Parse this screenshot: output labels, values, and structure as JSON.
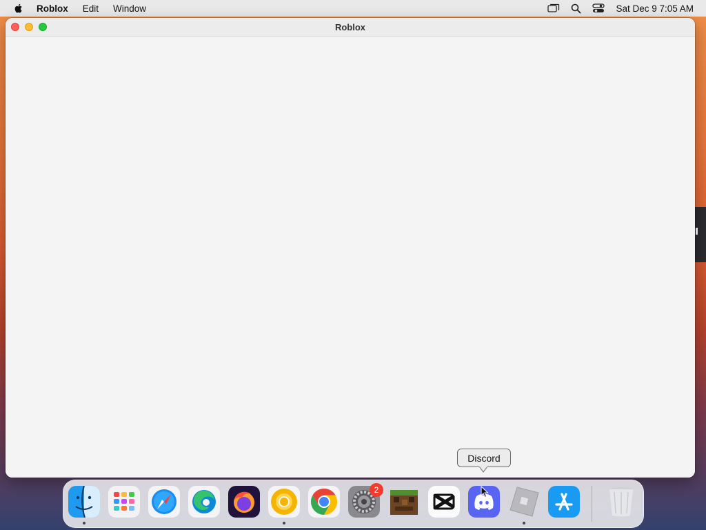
{
  "menubar": {
    "app_name": "Roblox",
    "items": [
      "Edit",
      "Window"
    ],
    "clock": "Sat Dec 9  7:05 AM",
    "icons": [
      "apple-icon",
      "screen-mirroring-icon",
      "spotlight-search-icon",
      "control-center-icon"
    ]
  },
  "window": {
    "title": "Roblox"
  },
  "tooltip": {
    "label": "Discord"
  },
  "dock": {
    "apps": [
      {
        "name": "Finder",
        "icon": "finder-icon",
        "running": true
      },
      {
        "name": "Launchpad",
        "icon": "launchpad-icon",
        "running": false
      },
      {
        "name": "Safari",
        "icon": "safari-icon",
        "running": false
      },
      {
        "name": "Microsoft Edge",
        "icon": "edge-icon",
        "running": false
      },
      {
        "name": "Firefox",
        "icon": "firefox-icon",
        "running": false
      },
      {
        "name": "Chrome Canary",
        "icon": "chrome-canary-icon",
        "running": true
      },
      {
        "name": "Google Chrome",
        "icon": "chrome-icon",
        "running": false
      },
      {
        "name": "System Settings",
        "icon": "system-settings-icon",
        "running": false,
        "badge": "2"
      },
      {
        "name": "Minecraft",
        "icon": "minecraft-icon",
        "running": false
      },
      {
        "name": "CapCut",
        "icon": "capcut-icon",
        "running": false
      },
      {
        "name": "Discord",
        "icon": "discord-icon",
        "running": false
      },
      {
        "name": "Roblox",
        "icon": "roblox-icon",
        "running": true
      },
      {
        "name": "App Store",
        "icon": "app-store-icon",
        "running": false
      },
      {
        "name": "Trash",
        "icon": "trash-icon",
        "running": false
      }
    ]
  },
  "colors": {
    "close": "#fe5f57",
    "minimize": "#febc2e",
    "maximize": "#28c840",
    "badge": "#f23a2f",
    "discord": "#5865f2"
  }
}
